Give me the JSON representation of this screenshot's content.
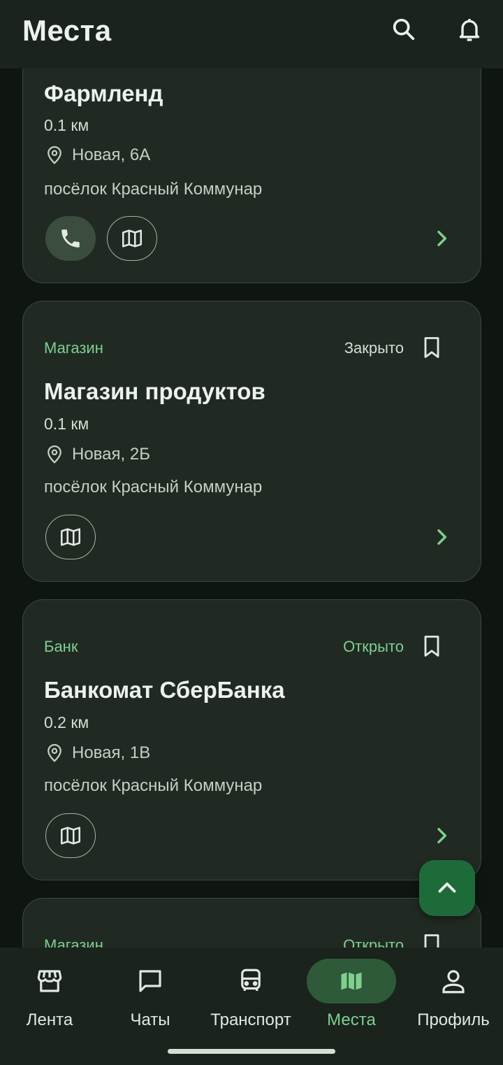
{
  "header": {
    "title": "Места"
  },
  "cards": [
    {
      "title": "Фармленд",
      "distance": "0.1 км",
      "address": "Новая, 6А",
      "locality": "посёлок Красный Коммунар"
    },
    {
      "category": "Магазин",
      "status": "Закрыто",
      "title": "Магазин продуктов",
      "distance": "0.1 км",
      "address": "Новая, 2Б",
      "locality": "посёлок Красный Коммунар"
    },
    {
      "category": "Банк",
      "status": "Открыто",
      "title": "Банкомат СберБанка",
      "distance": "0.2 км",
      "address": "Новая, 1В",
      "locality": "посёлок Красный Коммунар"
    },
    {
      "category": "Магазин",
      "status": "Открыто"
    }
  ],
  "nav": {
    "items": [
      {
        "label": "Лента",
        "icon": "storefront-icon"
      },
      {
        "label": "Чаты",
        "icon": "chat-icon"
      },
      {
        "label": "Транспорт",
        "icon": "bus-icon"
      },
      {
        "label": "Места",
        "icon": "map-icon",
        "active": true
      },
      {
        "label": "Профиль",
        "icon": "person-icon"
      }
    ]
  },
  "colors": {
    "accent": "#7fcf8e",
    "card_bg": "#202a23",
    "header_bg": "#1a231c",
    "fab_bg": "#1e6b3a"
  }
}
